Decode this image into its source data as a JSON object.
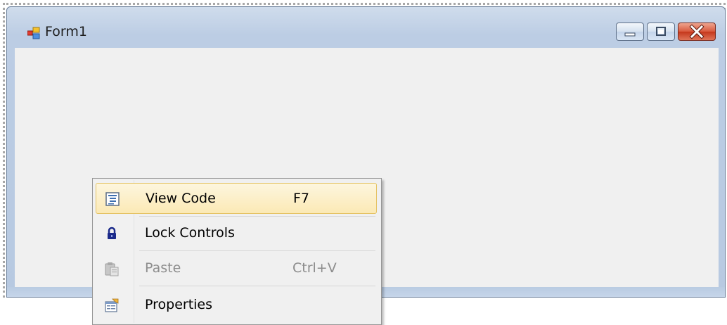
{
  "window": {
    "title": "Form1",
    "app_icon": "form-icon",
    "caption_buttons": [
      "minimize-icon",
      "maximize-icon",
      "close-icon"
    ]
  },
  "context_menu": {
    "items": [
      {
        "label": "View Code",
        "shortcut": "F7",
        "icon": "view-code-icon",
        "highlighted": true,
        "enabled": true
      },
      {
        "label": "Lock Controls",
        "shortcut": "",
        "icon": "lock-icon",
        "highlighted": false,
        "enabled": true
      },
      {
        "label": "Paste",
        "shortcut": "Ctrl+V",
        "icon": "paste-icon",
        "highlighted": false,
        "enabled": false
      },
      {
        "label": "Properties",
        "shortcut": "",
        "icon": "properties-icon",
        "highlighted": false,
        "enabled": true
      }
    ]
  },
  "colors": {
    "highlight_border": "#e5c365",
    "highlight_fill": "#fbe9b5",
    "close_button": "#c5361b",
    "client_area": "#f0f0f0",
    "titlebar": "#bccde4"
  }
}
